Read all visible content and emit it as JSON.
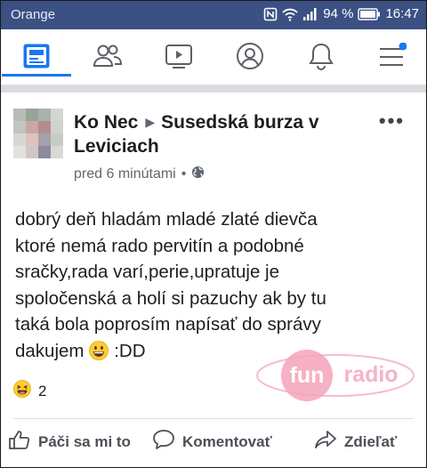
{
  "status": {
    "carrier": "Orange",
    "battery": "94 %",
    "time": "16:47"
  },
  "nav": {
    "items": [
      "news-feed",
      "friends",
      "watch",
      "profile",
      "notifications",
      "menu"
    ],
    "accent": "#1877f2"
  },
  "post": {
    "author": "Ko Nec",
    "group": "Susedská burza v Leviciach",
    "time": "pred 6 minútami",
    "separator": "•",
    "more": "•••",
    "text_lines": [
      "dobrý deň hladám mladé zlaté dievča",
      "ktoré nemá rado pervitín a podobné",
      "sračky,rada varí,perie,upratuje je",
      "spoločenská a holí si pazuchy ak by tu",
      "taká bola poprosím napísať do správy",
      "dakujem"
    ],
    "text_suffix": ":DD",
    "reaction_count": "2"
  },
  "watermark": {
    "part1": "fun",
    "part2": "radio"
  },
  "actions": {
    "like": "Páči sa mi to",
    "comment": "Komentovať",
    "share": "Zdieľať"
  }
}
